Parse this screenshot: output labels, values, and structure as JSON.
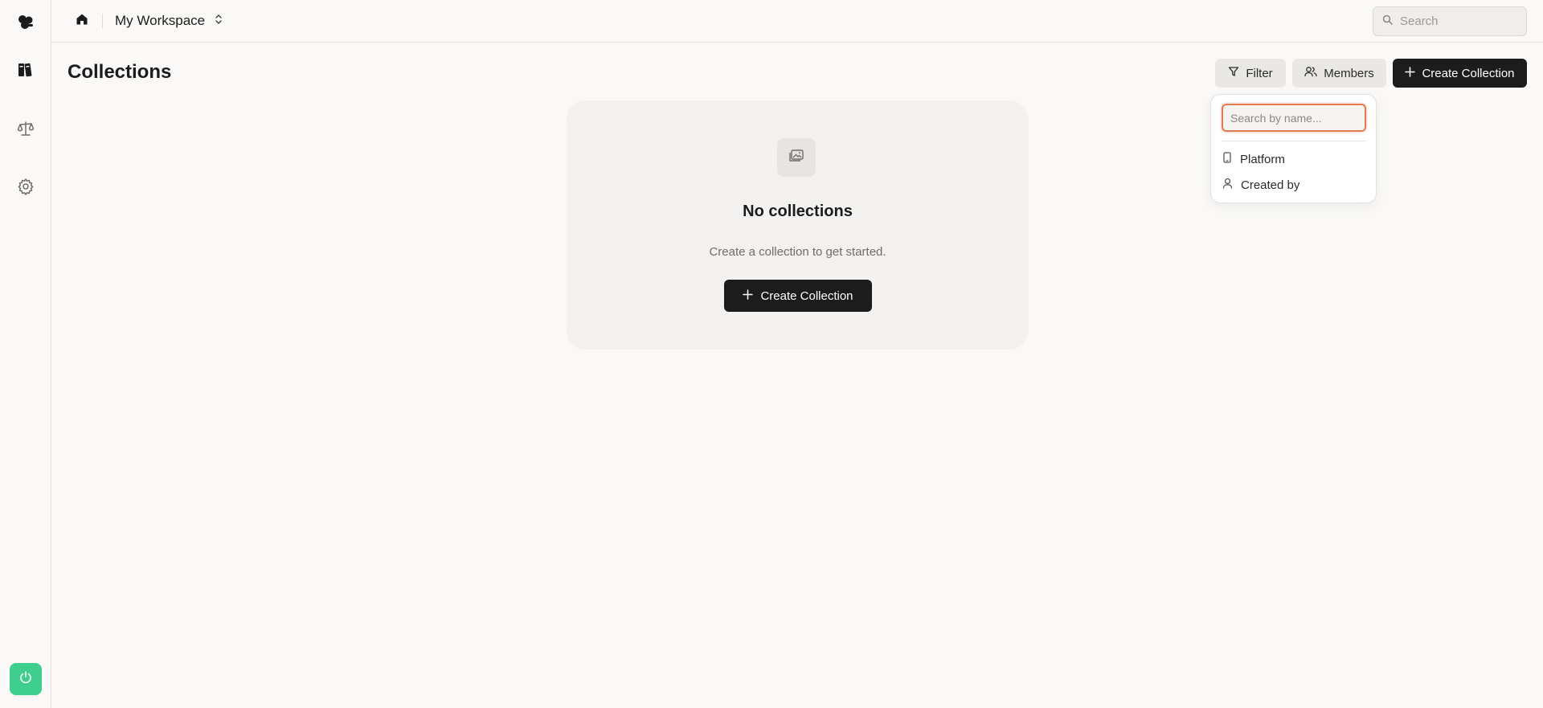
{
  "sidebar": {
    "items": [
      {
        "icon": "logo-icon"
      },
      {
        "icon": "library-icon"
      },
      {
        "icon": "scale-icon"
      },
      {
        "icon": "gear-icon"
      }
    ],
    "bottom_icon": "power-icon",
    "bottom_color": "#3ecf8e"
  },
  "topbar": {
    "workspace_name": "My Workspace",
    "search_placeholder": "Search"
  },
  "page": {
    "title": "Collections",
    "filter_label": "Filter",
    "members_label": "Members",
    "create_label": "Create Collection"
  },
  "empty_state": {
    "title": "No collections",
    "subtitle": "Create a collection to get started.",
    "button_label": "Create Collection"
  },
  "filter_menu": {
    "search_placeholder": "Search by name...",
    "options": [
      {
        "label": "Platform",
        "icon": "phone-icon"
      },
      {
        "label": "Created by",
        "icon": "user-icon"
      }
    ],
    "focus_color": "#e07a4f"
  }
}
